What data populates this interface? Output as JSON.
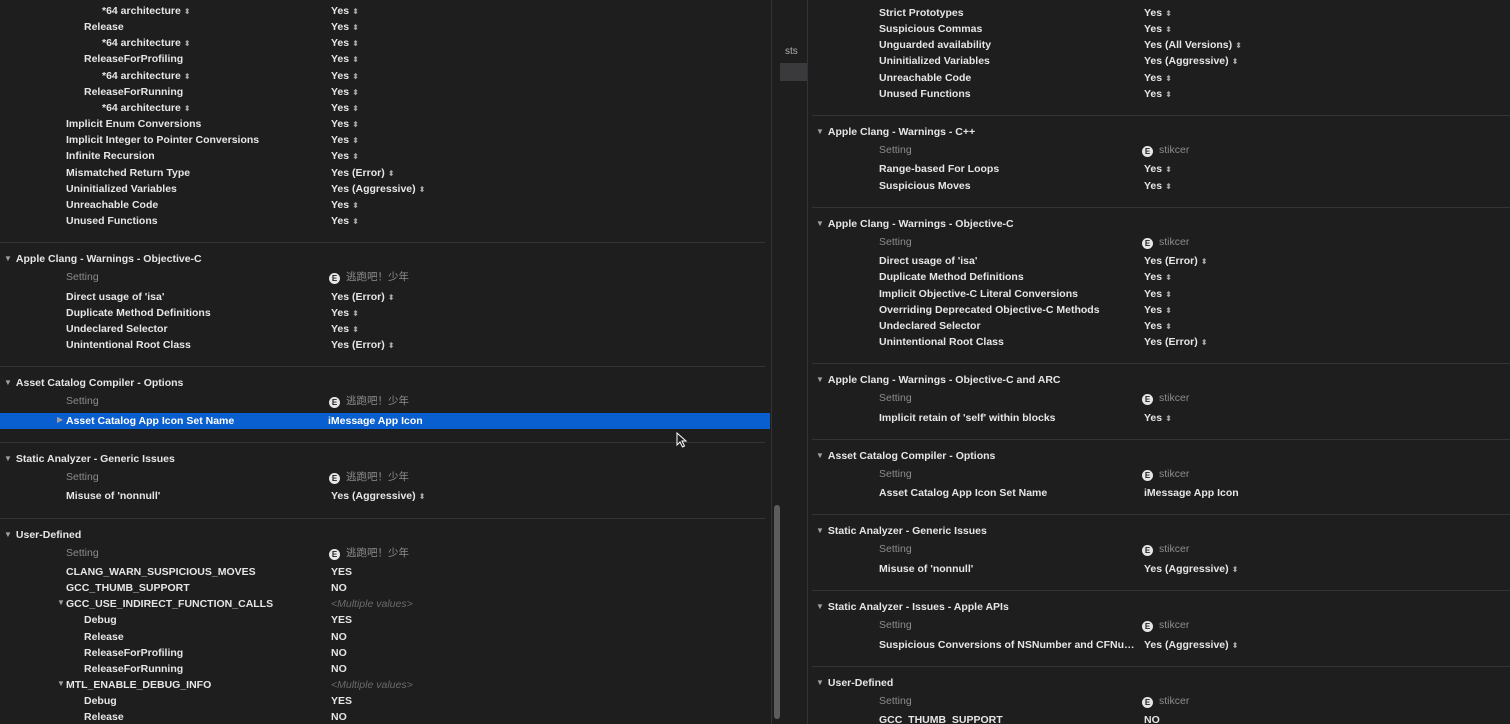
{
  "left": {
    "top_rows": [
      {
        "name": "*64 architecture",
        "value": "Yes",
        "indent": 2,
        "stepper_name": true
      },
      {
        "name": "Release",
        "value": "Yes",
        "indent": 1
      },
      {
        "name": "*64 architecture",
        "value": "Yes",
        "indent": 2,
        "stepper_name": true
      },
      {
        "name": "ReleaseForProfiling",
        "value": "Yes",
        "indent": 1
      },
      {
        "name": "*64 architecture",
        "value": "Yes",
        "indent": 2,
        "stepper_name": true
      },
      {
        "name": "ReleaseForRunning",
        "value": "Yes",
        "indent": 1
      },
      {
        "name": "*64 architecture",
        "value": "Yes",
        "indent": 2,
        "stepper_name": true
      },
      {
        "name": "Implicit Enum Conversions",
        "value": "Yes",
        "indent": 0
      },
      {
        "name": "Implicit Integer to Pointer Conversions",
        "value": "Yes",
        "indent": 0
      },
      {
        "name": "Infinite Recursion",
        "value": "Yes",
        "indent": 0
      },
      {
        "name": "Mismatched Return Type",
        "value": "Yes (Error)",
        "indent": 0
      },
      {
        "name": "Uninitialized Variables",
        "value": "Yes (Aggressive)",
        "indent": 0
      },
      {
        "name": "Unreachable Code",
        "value": "Yes",
        "indent": 0
      },
      {
        "name": "Unused Functions",
        "value": "Yes",
        "indent": 0
      }
    ],
    "sections": [
      {
        "title": "Apple Clang - Warnings - Objective-C",
        "header": {
          "setting": "Setting",
          "level_icon": "E",
          "target": "逃跑吧！少年"
        },
        "rows": [
          {
            "name": "Direct usage of 'isa'",
            "value": "Yes (Error)"
          },
          {
            "name": "Duplicate Method Definitions",
            "value": "Yes"
          },
          {
            "name": "Undeclared Selector",
            "value": "Yes"
          },
          {
            "name": "Unintentional Root Class",
            "value": "Yes (Error)"
          }
        ]
      },
      {
        "title": "Asset Catalog Compiler - Options",
        "header": {
          "setting": "Setting",
          "level_icon": "E",
          "target": "逃跑吧！少年"
        },
        "rows": [
          {
            "name": "Asset Catalog App Icon Set Name",
            "value": "iMessage App Icon",
            "selected": true
          }
        ]
      },
      {
        "title": "Static Analyzer - Generic Issues",
        "header": {
          "setting": "Setting",
          "level_icon": "E",
          "target": "逃跑吧！少年"
        },
        "rows": [
          {
            "name": "Misuse of 'nonnull'",
            "value": "Yes (Aggressive)"
          }
        ]
      },
      {
        "title": "User-Defined",
        "header": {
          "setting": "Setting",
          "level_icon": "E",
          "target": "逃跑吧！少年"
        },
        "rows": [
          {
            "name": "CLANG_WARN_SUSPICIOUS_MOVES",
            "value": "YES",
            "bold": true
          },
          {
            "name": "GCC_THUMB_SUPPORT",
            "value": "NO"
          },
          {
            "name": "GCC_USE_INDIRECT_FUNCTION_CALLS",
            "value": "<Multiple values>",
            "expandable": true,
            "multiple": true
          },
          {
            "name": "Debug",
            "value": "YES",
            "indent": 1
          },
          {
            "name": "Release",
            "value": "NO",
            "indent": 1
          },
          {
            "name": "ReleaseForProfiling",
            "value": "NO",
            "indent": 1
          },
          {
            "name": "ReleaseForRunning",
            "value": "NO",
            "indent": 1
          },
          {
            "name": "MTL_ENABLE_DEBUG_INFO",
            "value": "<Multiple values>",
            "expandable": true,
            "multiple": true,
            "bold": true
          },
          {
            "name": "Debug",
            "value": "YES",
            "indent": 1,
            "bold": true
          },
          {
            "name": "Release",
            "value": "NO",
            "indent": 1,
            "bold": true
          }
        ]
      }
    ]
  },
  "gutter_label": "sts",
  "right": {
    "top_rows": [
      {
        "name": "Strict Prototypes",
        "value": "Yes"
      },
      {
        "name": "Suspicious Commas",
        "value": "Yes"
      },
      {
        "name": "Unguarded availability",
        "value": "Yes (All Versions)"
      },
      {
        "name": "Uninitialized Variables",
        "value": "Yes (Aggressive)"
      },
      {
        "name": "Unreachable Code",
        "value": "Yes"
      },
      {
        "name": "Unused Functions",
        "value": "Yes"
      }
    ],
    "sections": [
      {
        "title": "Apple Clang - Warnings - C++",
        "header": {
          "setting": "Setting",
          "level_icon": "E",
          "target": "stikcer"
        },
        "rows": [
          {
            "name": "Range-based For Loops",
            "value": "Yes"
          },
          {
            "name": "Suspicious Moves",
            "value": "Yes"
          }
        ]
      },
      {
        "title": "Apple Clang - Warnings - Objective-C",
        "header": {
          "setting": "Setting",
          "level_icon": "E",
          "target": "stikcer"
        },
        "rows": [
          {
            "name": "Direct usage of 'isa'",
            "value": "Yes (Error)"
          },
          {
            "name": "Duplicate Method Definitions",
            "value": "Yes"
          },
          {
            "name": "Implicit Objective-C Literal Conversions",
            "value": "Yes"
          },
          {
            "name": "Overriding Deprecated Objective-C Methods",
            "value": "Yes"
          },
          {
            "name": "Undeclared Selector",
            "value": "Yes"
          },
          {
            "name": "Unintentional Root Class",
            "value": "Yes (Error)"
          }
        ]
      },
      {
        "title": "Apple Clang - Warnings - Objective-C and ARC",
        "header": {
          "setting": "Setting",
          "level_icon": "E",
          "target": "stikcer"
        },
        "rows": [
          {
            "name": "Implicit retain of 'self' within blocks",
            "value": "Yes"
          }
        ]
      },
      {
        "title": "Asset Catalog Compiler - Options",
        "header": {
          "setting": "Setting",
          "level_icon": "E",
          "target": "stikcer"
        },
        "rows": [
          {
            "name": "Asset Catalog App Icon Set Name",
            "value": "iMessage App Icon",
            "no_stepper": true
          }
        ]
      },
      {
        "title": "Static Analyzer - Generic Issues",
        "header": {
          "setting": "Setting",
          "level_icon": "E",
          "target": "stikcer"
        },
        "rows": [
          {
            "name": "Misuse of 'nonnull'",
            "value": "Yes (Aggressive)"
          }
        ]
      },
      {
        "title": "Static Analyzer - Issues - Apple APIs",
        "header": {
          "setting": "Setting",
          "level_icon": "E",
          "target": "stikcer"
        },
        "rows": [
          {
            "name": "Suspicious Conversions of NSNumber and CFNum…",
            "value": "Yes (Aggressive)"
          }
        ]
      },
      {
        "title": "User-Defined",
        "header": {
          "setting": "Setting",
          "level_icon": "E",
          "target": "stikcer"
        },
        "rows": [
          {
            "name": "GCC_THUMB_SUPPORT",
            "value": "NO",
            "no_stepper": true
          }
        ]
      }
    ]
  },
  "colors": {
    "background": "#1e1e1f",
    "selection": "#0a5fd0",
    "separator": "#343435",
    "text": "#e6e6e6",
    "muted": "#8c8c8c"
  },
  "icons": {
    "disclosure": "disclosure-triangle-icon",
    "stepper": "up-down-stepper-icon",
    "level": "resolved-level-icon",
    "cursor": "mouse-pointer-icon"
  }
}
